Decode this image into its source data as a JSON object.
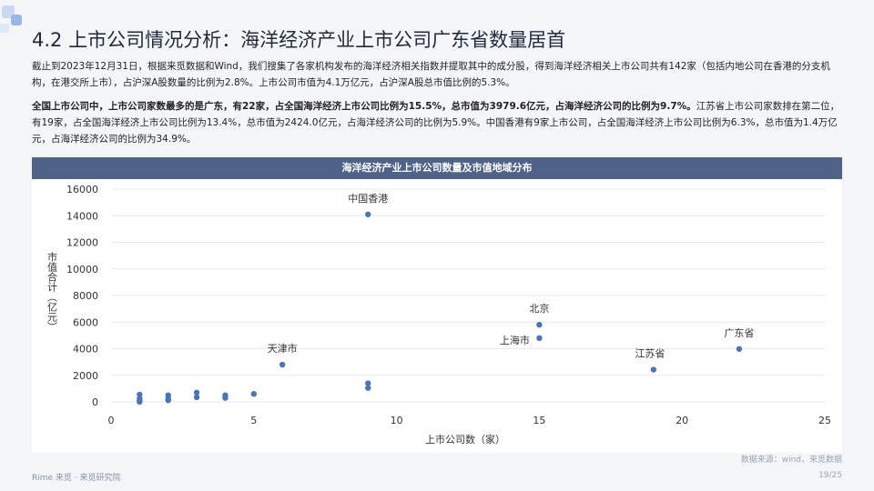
{
  "slide": {
    "title": "4.2 上市公司情况分析：海洋经济产业上市公司广东省数量居首",
    "para1": "截止到2023年12月31日，根据来觅数据和Wind，我们搜集了各家机构发布的海洋经济相关指数并提取其中的成分股，得到海洋经济相关上市公司共有142家（包括内地公司在香港的分支机构，在港交所上市），占沪深A股数量的比例为2.8%。上市公司市值为4.1万亿元，占沪深A股总市值比例的5.3%。",
    "para2_bold": "全国上市公司中，上市公司家数最多的是广东，有22家，占全国海洋经济上市公司比例为15.5%，总市值为3979.6亿元，占海洋经济公司的比例为9.7%。",
    "para2_rest": "江苏省上市公司家数排在第二位，有19家，占全国海洋经济上市公司比例为13.4%，总市值为2424.0亿元，占海洋经济公司的比例为5.9%。中国香港有9家上市公司，占全国海洋经济上市公司比例为6.3%，总市值为1.4万亿元，占海洋经济公司的比例为34.9%。",
    "source": "数据来源：wind，来觅数据",
    "brand": "Rime 来觅 · 来觅研究院",
    "page": "19/25"
  },
  "chart_data": {
    "type": "scatter",
    "title": "海洋经济产业上市公司数量及市值地域分布",
    "xlabel": "上市公司数（家）",
    "ylabel": "市值合计（亿元）",
    "xlim": [
      0,
      25
    ],
    "ylim": [
      0,
      16000
    ],
    "xticks": [
      0,
      5,
      10,
      15,
      20,
      25
    ],
    "yticks": [
      0,
      2000,
      4000,
      6000,
      8000,
      10000,
      12000,
      14000,
      16000
    ],
    "grid": "horizontal",
    "points": [
      {
        "x": 9,
        "y": 14100,
        "label": "中国香港",
        "lx": 0,
        "ly": -14
      },
      {
        "x": 15,
        "y": 5800,
        "label": "北京",
        "lx": 0,
        "ly": -14
      },
      {
        "x": 15,
        "y": 4800,
        "label": "上海市",
        "lx": -27,
        "ly": 6
      },
      {
        "x": 22,
        "y": 3980,
        "label": "广东省",
        "lx": 0,
        "ly": -14
      },
      {
        "x": 19,
        "y": 2424,
        "label": "江苏省",
        "lx": -4,
        "ly": -14
      },
      {
        "x": 6,
        "y": 2800,
        "label": "天津市",
        "lx": 0,
        "ly": -14
      },
      {
        "x": 9,
        "y": 1400,
        "label": ""
      },
      {
        "x": 9,
        "y": 1050,
        "label": ""
      },
      {
        "x": 5,
        "y": 600,
        "label": ""
      },
      {
        "x": 4,
        "y": 500,
        "label": ""
      },
      {
        "x": 4,
        "y": 300,
        "label": ""
      },
      {
        "x": 3,
        "y": 700,
        "label": ""
      },
      {
        "x": 3,
        "y": 350,
        "label": ""
      },
      {
        "x": 2,
        "y": 500,
        "label": ""
      },
      {
        "x": 2,
        "y": 250,
        "label": ""
      },
      {
        "x": 2,
        "y": 120,
        "label": ""
      },
      {
        "x": 1,
        "y": 550,
        "label": ""
      },
      {
        "x": 1,
        "y": 250,
        "label": ""
      },
      {
        "x": 1,
        "y": 120,
        "label": ""
      },
      {
        "x": 1,
        "y": 50,
        "label": ""
      },
      {
        "x": 1,
        "y": 10,
        "label": ""
      }
    ],
    "point_color": "#4a74b8"
  }
}
